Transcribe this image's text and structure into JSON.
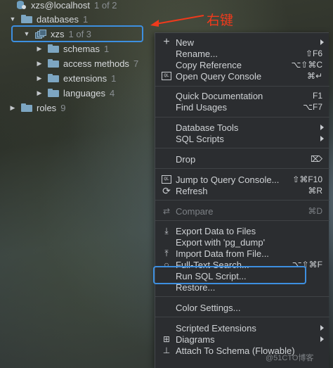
{
  "tree": {
    "connection": {
      "label": "xzs@localhost",
      "count": "1 of 2"
    },
    "databases": {
      "label": "databases",
      "count": "1"
    },
    "xzs": {
      "label": "xzs",
      "count": "1 of 3"
    },
    "children": [
      {
        "label": "schemas",
        "count": "1"
      },
      {
        "label": "access methods",
        "count": "7"
      },
      {
        "label": "extensions",
        "count": "1"
      },
      {
        "label": "languages",
        "count": "4"
      }
    ],
    "roles": {
      "label": "roles",
      "count": "9"
    }
  },
  "annotation": {
    "text": "右键",
    "color": "#f03a1c"
  },
  "menu": {
    "items": [
      {
        "label": "New",
        "icon": "plus-icon",
        "shortcut": "",
        "submenu": true
      },
      {
        "label": "Rename...",
        "shortcut": "⇧F6"
      },
      {
        "label": "Copy Reference",
        "shortcut": "⌥⇧⌘C"
      },
      {
        "label": "Open Query Console",
        "icon": "ql-console-icon",
        "shortcut": "⌘↵"
      },
      {
        "label": "Quick Documentation",
        "shortcut": "F1"
      },
      {
        "label": "Find Usages",
        "shortcut": "⌥F7"
      },
      {
        "label": "Database Tools",
        "submenu": true
      },
      {
        "label": "SQL Scripts",
        "submenu": true
      },
      {
        "label": "Drop",
        "shortcut": "⌦"
      },
      {
        "label": "Jump to Query Console...",
        "icon": "ql-console-icon",
        "shortcut": "⇧⌘F10"
      },
      {
        "label": "Refresh",
        "icon": "refresh-icon",
        "shortcut": "⌘R"
      },
      {
        "label": "Compare",
        "icon": "compare-icon",
        "shortcut": "⌘D",
        "disabled": true
      },
      {
        "label": "Export Data to Files",
        "icon": "download-icon"
      },
      {
        "label": "Export with 'pg_dump'"
      },
      {
        "label": "Import Data from File...",
        "icon": "upload-icon"
      },
      {
        "label": "Full-Text Search...",
        "icon": "search-icon",
        "shortcut": "⌥⇧⌘F"
      },
      {
        "label": "Run SQL Script..."
      },
      {
        "label": "Restore..."
      },
      {
        "label": "Color Settings..."
      },
      {
        "label": "Scripted Extensions",
        "submenu": true
      },
      {
        "label": "Diagrams",
        "icon": "diagram-icon",
        "submenu": true
      },
      {
        "label": "Attach To Schema (Flowable)",
        "icon": "attach-icon"
      }
    ]
  },
  "watermark": "@51CTO博客",
  "colors": {
    "highlight_border": "#3d8fe0",
    "menu_bg": "#2b2d30",
    "folder": "#7da6c2"
  }
}
